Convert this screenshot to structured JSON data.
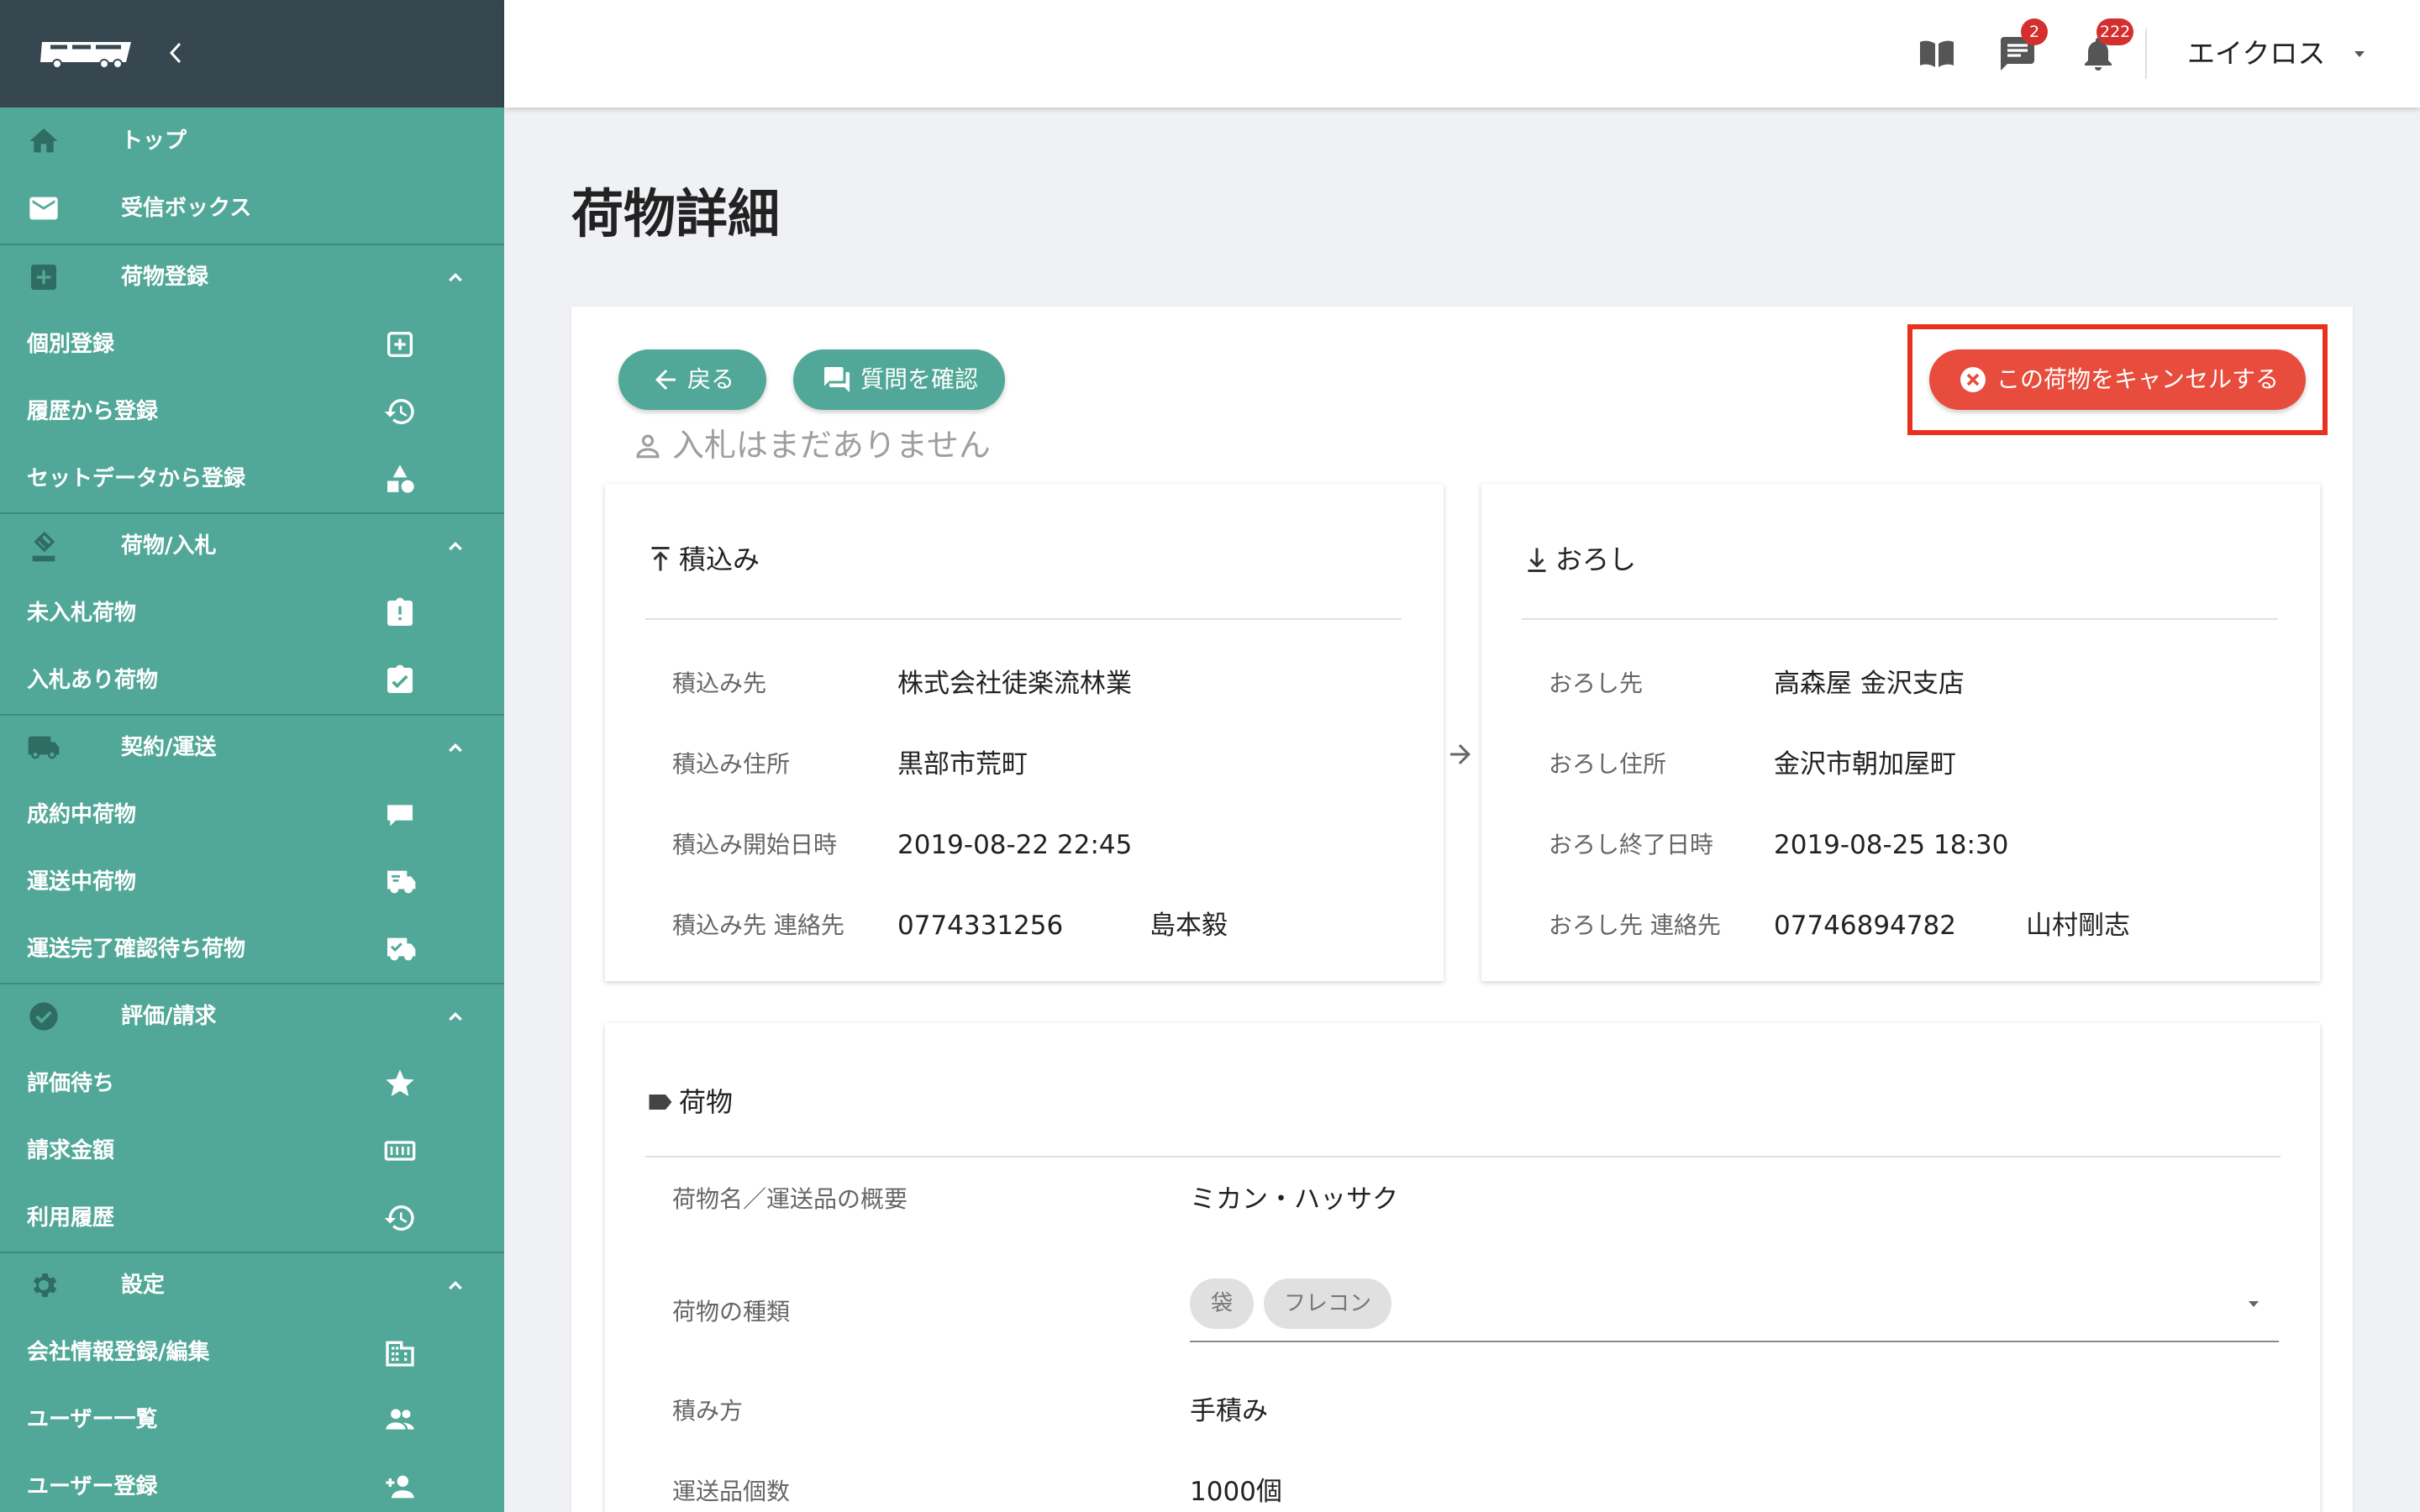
{
  "colors": {
    "sidebar_bg": "#52a898",
    "sidebar_header_bg": "#37474f",
    "primary_button": "#52a898",
    "cancel_button": "#e74c3c",
    "highlight_border": "#e8321d",
    "badge": "#d32f2f",
    "page_bg": "#f0f1f5"
  },
  "sidebar": {
    "items": [
      {
        "label": "トップ",
        "icon": "home-icon"
      },
      {
        "label": "受信ボックス",
        "icon": "mail-icon"
      },
      {
        "label": "荷物登録",
        "icon": "add-box-icon",
        "section": true
      },
      {
        "label": "個別登録",
        "icon": "plus-square-icon"
      },
      {
        "label": "履歴から登録",
        "icon": "history-icon"
      },
      {
        "label": "セットデータから登録",
        "icon": "shapes-icon"
      },
      {
        "label": "荷物/入札",
        "icon": "bid-hammer-icon",
        "section": true
      },
      {
        "label": "未入札荷物",
        "icon": "clipboard-alert-icon"
      },
      {
        "label": "入札あり荷物",
        "icon": "clipboard-check-icon"
      },
      {
        "label": "契約/運送",
        "icon": "truck-icon",
        "section": true
      },
      {
        "label": "成約中荷物",
        "icon": "truck-front-icon"
      },
      {
        "label": "運送中荷物",
        "icon": "truck-fast-icon"
      },
      {
        "label": "運送完了確認待ち荷物",
        "icon": "truck-check-icon"
      },
      {
        "label": "評価/請求",
        "icon": "check-circle-icon",
        "section": true
      },
      {
        "label": "評価待ち",
        "icon": "star-icon"
      },
      {
        "label": "請求金額",
        "icon": "counter-icon"
      },
      {
        "label": "利用履歴",
        "icon": "history-icon"
      },
      {
        "label": "設定",
        "icon": "gear-icon",
        "section": true
      },
      {
        "label": "会社情報登録/編集",
        "icon": "building-icon"
      },
      {
        "label": "ユーザー一覧",
        "icon": "users-icon"
      },
      {
        "label": "ユーザー登録",
        "icon": "add-user-icon"
      }
    ]
  },
  "topbar": {
    "messages_badge": "2",
    "notifications_badge": "222",
    "user_name": "エイクロス"
  },
  "page": {
    "title": "荷物詳細",
    "back_label": "戻る",
    "question_label": "質問を確認",
    "cancel_label": "この荷物をキャンセルする",
    "no_bids": "入札はまだありません"
  },
  "pickup": {
    "header": "積込み",
    "rows": [
      {
        "label": "積込み先",
        "value": "株式会社徒楽流林業"
      },
      {
        "label": "積込み住所",
        "value": "黒部市荒町"
      },
      {
        "label": "積込み開始日時",
        "value": "2019-08-22 22:45"
      },
      {
        "label": "積込み先 連絡先",
        "value": "0774331256",
        "person": "島本毅"
      }
    ]
  },
  "dropoff": {
    "header": "おろし",
    "rows": [
      {
        "label": "おろし先",
        "value": "高森屋 金沢支店"
      },
      {
        "label": "おろし住所",
        "value": "金沢市朝加屋町"
      },
      {
        "label": "おろし終了日時",
        "value": "2019-08-25 18:30"
      },
      {
        "label": "おろし先 連絡先",
        "value": "07746894782",
        "person": "山村剛志"
      }
    ]
  },
  "cargo": {
    "header": "荷物",
    "name_label": "荷物名／運送品の概要",
    "name_value": "ミカン・ハッサク",
    "type_label": "荷物の種類",
    "type_chips": [
      "袋",
      "フレコン"
    ],
    "loading_label": "積み方",
    "loading_value": "手積み",
    "count_label": "運送品個数",
    "count_value": "1000個"
  }
}
